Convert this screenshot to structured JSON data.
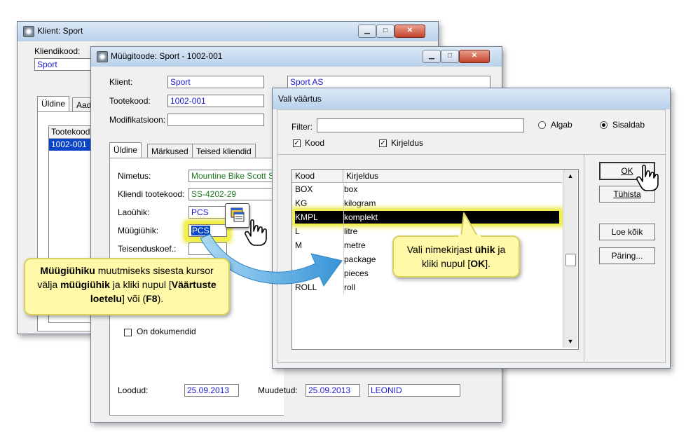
{
  "win_client": {
    "title": "Klient: Sport",
    "kliendikood_label": "Kliendikood:",
    "kliendikood_value": "Sport",
    "tab_yldine": "Üldine",
    "tab_aad": "Aad",
    "list_header": "Tootekood",
    "list_item": "1002-001"
  },
  "win_product": {
    "title": "Müügitoode: Sport - 1002-001",
    "klient_label": "Klient:",
    "klient_value": "Sport",
    "klient_name": "Sport AS",
    "tootekood_label": "Tootekood:",
    "tootekood_value": "1002-001",
    "modifikatsioon_label": "Modifikatsioon:",
    "tabs": [
      "Üldine",
      "Märkused",
      "Teised kliendid"
    ],
    "nimetus_label": "Nimetus:",
    "nimetus_value": "Mountine Bike Scott S",
    "kliendi_tootekood_label": "Kliendi tootekood:",
    "kliendi_tootekood_value": "SS-4202-29",
    "laouhik_label": "Laoühik:",
    "laouhik_value": "PCS",
    "muugiuhik_label": "Müügiühik:",
    "muugiuhik_value": "PCS",
    "teisenduskoef_label": "Teisenduskoef.:",
    "on_dokumendid_label": "On dokumendid",
    "loodud_label": "Loodud:",
    "loodud_value": "25.09.2013",
    "muudetud_label": "Muudetud:",
    "muudetud_value": "25.09.2013",
    "muutja_value": "LEONID"
  },
  "win_dialog": {
    "title": "Vali väärtus",
    "filter_label": "Filter:",
    "filter_value": "",
    "radio_algab": "Algab",
    "radio_sisaldab": "Sisaldab",
    "chk_kood": "Kood",
    "chk_kirjeldus": "Kirjeldus",
    "col_kood": "Kood",
    "col_kirjeldus": "Kirjeldus",
    "rows": [
      {
        "kood": "BOX",
        "kirjeldus": "box"
      },
      {
        "kood": "KG",
        "kirjeldus": "kilogram"
      },
      {
        "kood": "KMPL",
        "kirjeldus": "komplekt"
      },
      {
        "kood": "L",
        "kirjeldus": "litre"
      },
      {
        "kood": "M",
        "kirjeldus": "metre"
      },
      {
        "kood": "",
        "kirjeldus": "package"
      },
      {
        "kood": "",
        "kirjeldus": "pieces"
      },
      {
        "kood": "ROLL",
        "kirjeldus": "roll"
      }
    ],
    "btn_ok": "OK",
    "btn_tuhista": "Tühista",
    "btn_loe_koik": "Loe kõik",
    "btn_paring": "Päring..."
  },
  "callout_left": {
    "p1": "Müügiühiku",
    "p2": " muutmiseks sisesta kursor välja ",
    "p3": "müügiühik",
    "p4": "  ja kliki nupul [",
    "p5": "Väärtuste loetelu",
    "p6": "] või (",
    "p7": "F8",
    "p8": ")."
  },
  "callout_right": {
    "p1": "Vali nimekirjast ",
    "p2": "ühik",
    "p3": " ja kliki nupul [",
    "p4": "OK",
    "p5": "]."
  },
  "colors": {
    "highlight_yellow": "#f4f04a",
    "selected_row": "#000000",
    "accent_blue": "#1a1ad6",
    "callout_bg": "#fff9a8",
    "arrow_blue": "#3fa6e0"
  }
}
